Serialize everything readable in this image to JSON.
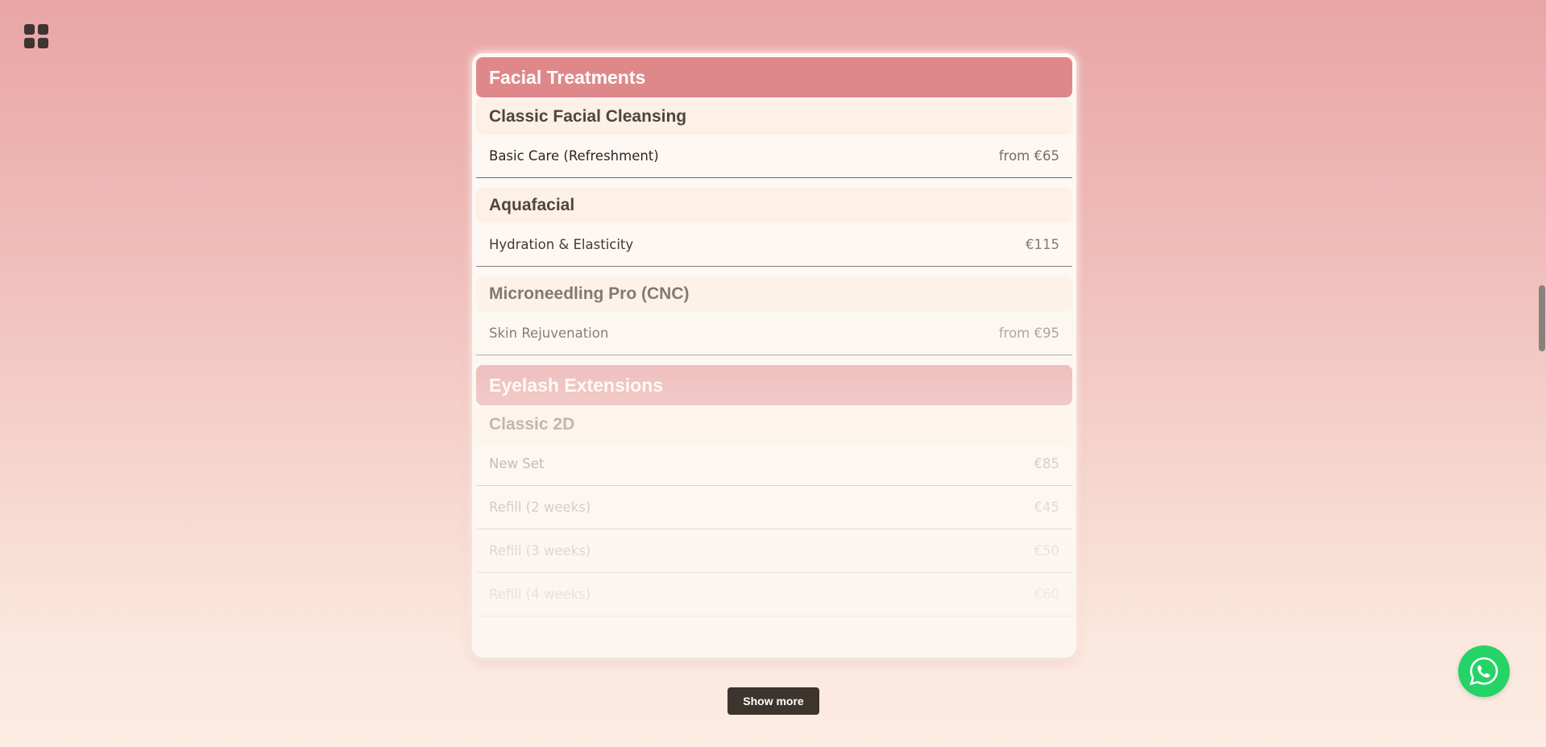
{
  "nav": {
    "menu_icon": "grid-icon"
  },
  "menu": {
    "categories": [
      {
        "title": "Facial Treatments",
        "groups": [
          {
            "title": "Classic Facial Cleansing",
            "items": [
              {
                "name": "Basic Care (Refreshment)",
                "price": "from €65"
              }
            ]
          },
          {
            "title": "Aquafacial",
            "items": [
              {
                "name": "Hydration & Elasticity",
                "price": "€115"
              }
            ]
          },
          {
            "title": "Microneedling Pro (CNC)",
            "items": [
              {
                "name": "Skin Rejuvenation",
                "price": "from €95"
              }
            ]
          }
        ]
      },
      {
        "title": "Eyelash Extensions",
        "groups": [
          {
            "title": "Classic 2D",
            "items": [
              {
                "name": "New Set",
                "price": "€85"
              },
              {
                "name": "Refill (2 weeks)",
                "price": "€45"
              },
              {
                "name": "Refill (3 weeks)",
                "price": "€50"
              },
              {
                "name": "Refill (4 weeks)",
                "price": "€60"
              }
            ]
          }
        ]
      }
    ]
  },
  "show_more": {
    "label": "Show more"
  },
  "whatsapp": {
    "icon": "whatsapp-icon",
    "color": "#25d366"
  },
  "colors": {
    "category_header": "#df888a",
    "subheader": "#fdf0e5",
    "button": "#3d342d"
  }
}
